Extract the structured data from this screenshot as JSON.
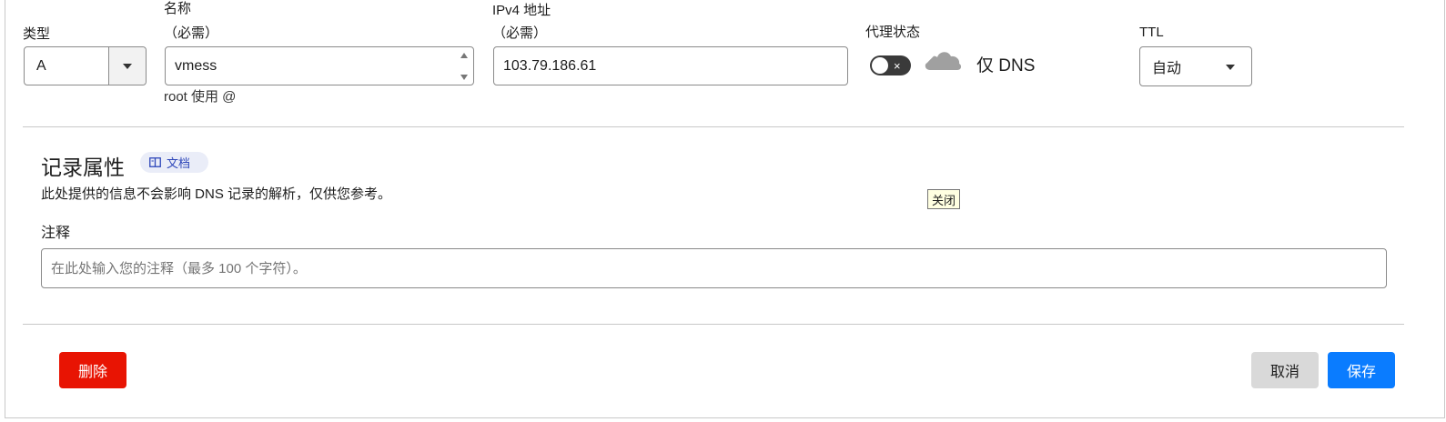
{
  "fields": {
    "type": {
      "label": "类型",
      "value": "A"
    },
    "name": {
      "label_line1": "名称",
      "label_line2": "（必需）",
      "value": "vmess",
      "hint": "root 使用 @"
    },
    "ipv4": {
      "label_line1": "IPv4 地址",
      "label_line2": "（必需）",
      "value": "103.79.186.61"
    },
    "proxy": {
      "label": "代理状态",
      "status_text": "仅 DNS",
      "toggle_symbol": "×",
      "enabled": false
    },
    "ttl": {
      "label": "TTL",
      "value": "自动"
    }
  },
  "record_attributes": {
    "title": "记录属性",
    "docs_label": "文档",
    "description": "此处提供的信息不会影响 DNS 记录的解析，仅供您参考。",
    "comment_label": "注释",
    "comment_placeholder": "在此处输入您的注释（最多 100 个字符）。"
  },
  "tooltip": "关闭",
  "buttons": {
    "delete": "删除",
    "cancel": "取消",
    "save": "保存"
  },
  "colors": {
    "delete": "#e81403",
    "cancel": "#d9d9d9",
    "save": "#0a7cff",
    "docs_text": "#2d46b9",
    "docs_bg": "#eaedf8",
    "toggle_off": "#3a3a3a",
    "cloud": "#a0a0a0"
  },
  "icons": {
    "type_dropdown": "caret-down-icon",
    "name_spinner": "spinner-icon",
    "proxy_cloud": "cloud-icon",
    "docs": "book-icon",
    "ttl_dropdown": "caret-down-icon"
  }
}
